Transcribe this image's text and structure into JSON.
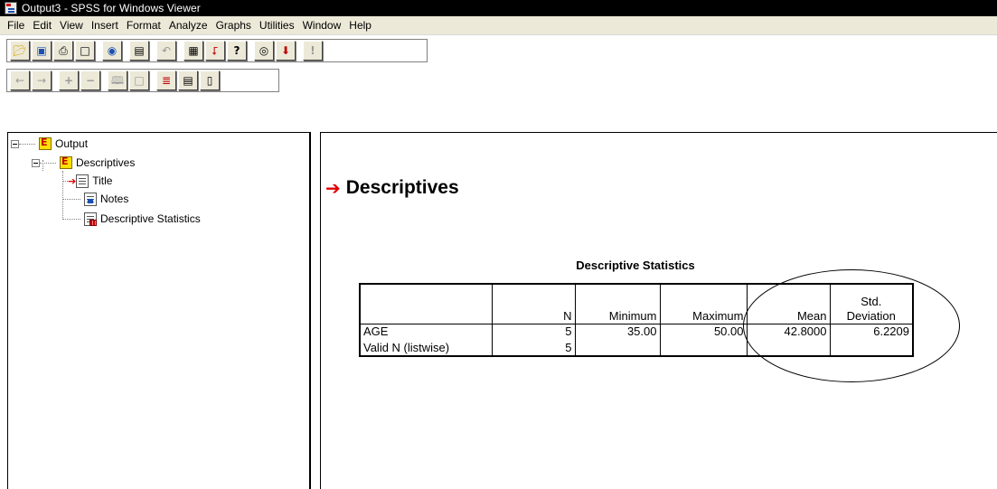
{
  "window": {
    "title": "Output3 - SPSS for Windows Viewer"
  },
  "menu": [
    "File",
    "Edit",
    "View",
    "Insert",
    "Format",
    "Analyze",
    "Graphs",
    "Utilities",
    "Window",
    "Help"
  ],
  "toolbar1_icons": [
    "open-icon",
    "save-icon",
    "print-icon",
    "print-preview-icon",
    "export-icon",
    "dialog-recall-icon",
    "undo-icon",
    "goto-data-icon",
    "goto-case-icon",
    "variables-icon",
    "use-sets-icon",
    "select-last-output-icon",
    "designate-window-icon"
  ],
  "toolbar2_icons": [
    "promote-icon",
    "demote-icon",
    "expand-icon",
    "collapse-icon",
    "show-icon",
    "hide-icon",
    "insert-heading-icon",
    "insert-title-icon",
    "insert-text-icon"
  ],
  "tree": {
    "root": "Output",
    "child": "Descriptives",
    "leaves": [
      "Title",
      "Notes",
      "Descriptive Statistics"
    ]
  },
  "output": {
    "heading": "Descriptives",
    "table": {
      "title": "Descriptive Statistics",
      "headers": [
        "",
        "N",
        "Minimum",
        "Maximum",
        "Mean",
        "Std.",
        "Deviation"
      ],
      "rows": [
        {
          "label": "AGE",
          "n": "5",
          "min": "35.00",
          "max": "50.00",
          "mean": "42.8000",
          "sd": "6.2209"
        },
        {
          "label": "Valid N (listwise)",
          "n": "5",
          "min": "",
          "max": "",
          "mean": "",
          "sd": ""
        }
      ]
    }
  }
}
